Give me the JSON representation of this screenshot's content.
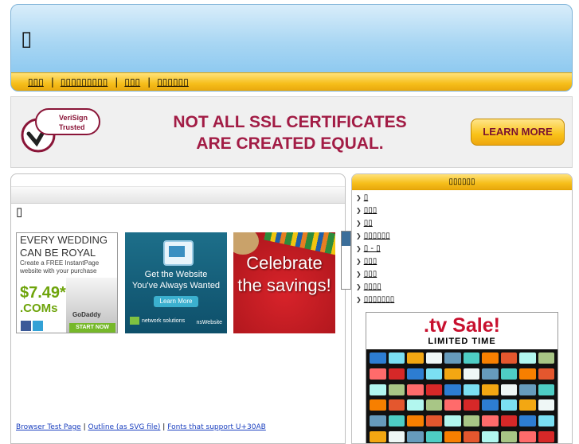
{
  "header": {
    "logo_glyph": "▯",
    "nav": [
      {
        "label": "▯▯▯"
      },
      {
        "label": "▯▯▯▯▯▯▯▯▯"
      },
      {
        "label": "▯▯▯"
      },
      {
        "label": "▯▯▯▯▯▯"
      }
    ],
    "separator": "|"
  },
  "banner": {
    "badge_text": "VeriSign Trusted",
    "headline_line1": "NOT ALL SSL CERTIFICATES",
    "headline_line2": "ARE CREATED EQUAL.",
    "cta": "LEARN MORE"
  },
  "content": {
    "glyph": "▯",
    "ads": {
      "godaddy": {
        "line1": "EVERY WEDDING",
        "line2": "CAN BE ROYAL",
        "line3": "Create a FREE InstantPage website with your purchase",
        "price": "$7.49*",
        "coms": ".COMs",
        "brand": "GoDaddy",
        "cta": "START NOW"
      },
      "network_solutions": {
        "line1": "Get the Website",
        "line2": "You've Always Wanted",
        "cta": "Learn More",
        "brand": "network solutions",
        "sub": "nsWebsite"
      },
      "celebrate": {
        "text": "Celebrate the savings!"
      }
    },
    "footer_links": [
      {
        "label": "Browser Test Page"
      },
      {
        "label": "Outline (as SVG file)"
      },
      {
        "label": "Fonts that support U+30AB"
      }
    ],
    "footer_sep": "|"
  },
  "sidebar": {
    "title": "▯▯▯▯▯▯",
    "arrow": "❯",
    "items": [
      {
        "label": "▯"
      },
      {
        "label": "▯▯▯"
      },
      {
        "label": "▯▯"
      },
      {
        "label": "▯▯▯▯▯▯"
      },
      {
        "label": "▯ - ▯"
      },
      {
        "label": "▯▯▯"
      },
      {
        "label": "▯▯▯"
      },
      {
        "label": "▯▯▯▯"
      },
      {
        "label": "▯▯▯▯▯▯▯"
      }
    ],
    "tv_ad": {
      "tv": ".tv",
      "sale": " Sale!",
      "limited": "LIMITED TIME"
    }
  },
  "colors": {
    "header_blue": "#7fc2ee",
    "nav_yellow": "#f6be1a",
    "banner_red": "#a21c45",
    "link_blue": "#1a3fbf"
  }
}
